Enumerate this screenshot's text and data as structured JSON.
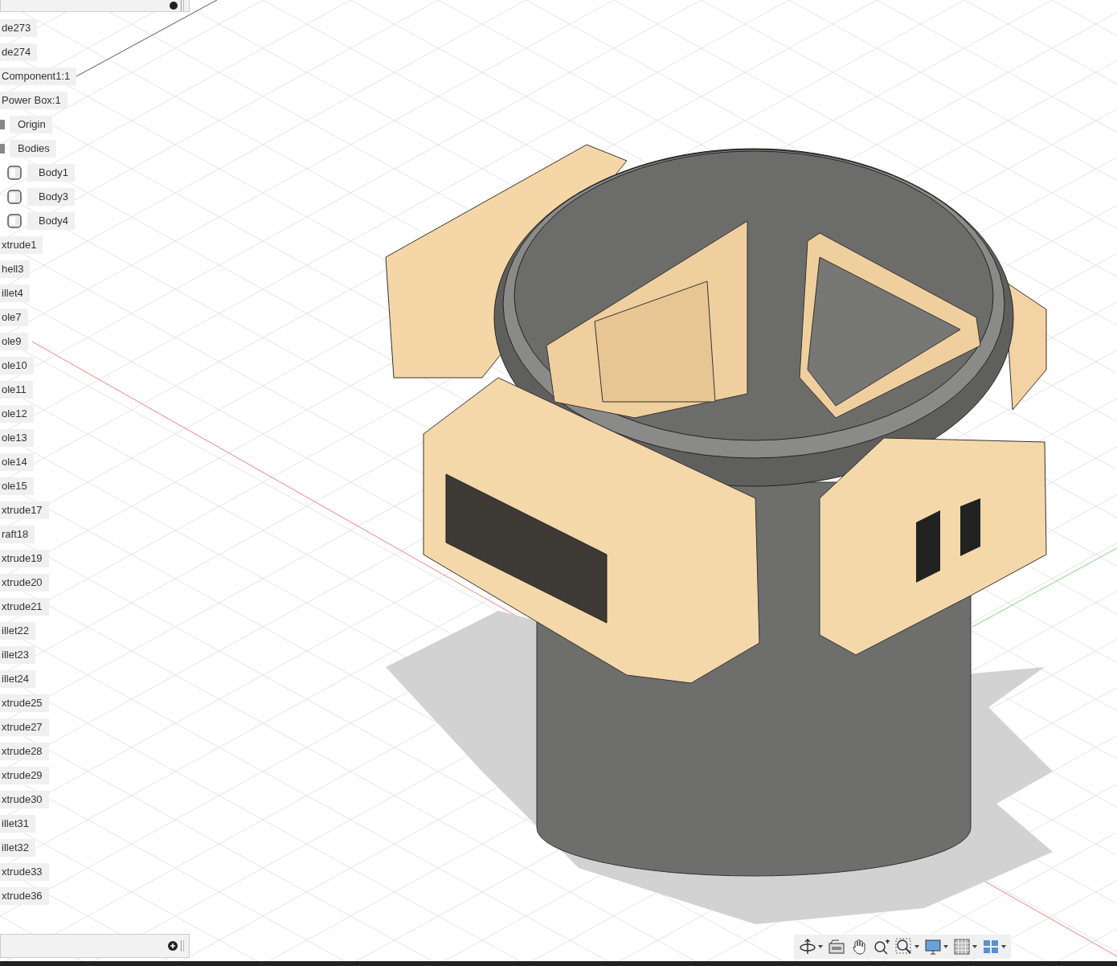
{
  "browser": {
    "items": [
      {
        "label": "de273"
      },
      {
        "label": "de274"
      },
      {
        "label": "Component1:1"
      },
      {
        "label": "Power Box:1",
        "children": [
          {
            "label": "Origin",
            "kind": "folder"
          },
          {
            "label": "Bodies",
            "kind": "folder",
            "children": [
              {
                "label": "Body1",
                "kind": "body"
              },
              {
                "label": "Body3",
                "kind": "body"
              },
              {
                "label": "Body4",
                "kind": "body"
              }
            ]
          }
        ]
      },
      {
        "label": "xtrude1"
      },
      {
        "label": "hell3"
      },
      {
        "label": "illet4"
      },
      {
        "label": "ole7"
      },
      {
        "label": "ole9"
      },
      {
        "label": "ole10"
      },
      {
        "label": "ole11"
      },
      {
        "label": "ole12"
      },
      {
        "label": "ole13"
      },
      {
        "label": "ole14"
      },
      {
        "label": "ole15"
      },
      {
        "label": "xtrude17"
      },
      {
        "label": "raft18"
      },
      {
        "label": "xtrude19"
      },
      {
        "label": "xtrude20"
      },
      {
        "label": "xtrude21"
      },
      {
        "label": "illet22"
      },
      {
        "label": "illet23"
      },
      {
        "label": "illet24"
      },
      {
        "label": "xtrude25"
      },
      {
        "label": "xtrude27"
      },
      {
        "label": "xtrude28"
      },
      {
        "label": "xtrude29"
      },
      {
        "label": "xtrude30"
      },
      {
        "label": "illet31"
      },
      {
        "label": "illet32"
      },
      {
        "label": "xtrude33"
      },
      {
        "label": "xtrude36"
      }
    ]
  }
}
